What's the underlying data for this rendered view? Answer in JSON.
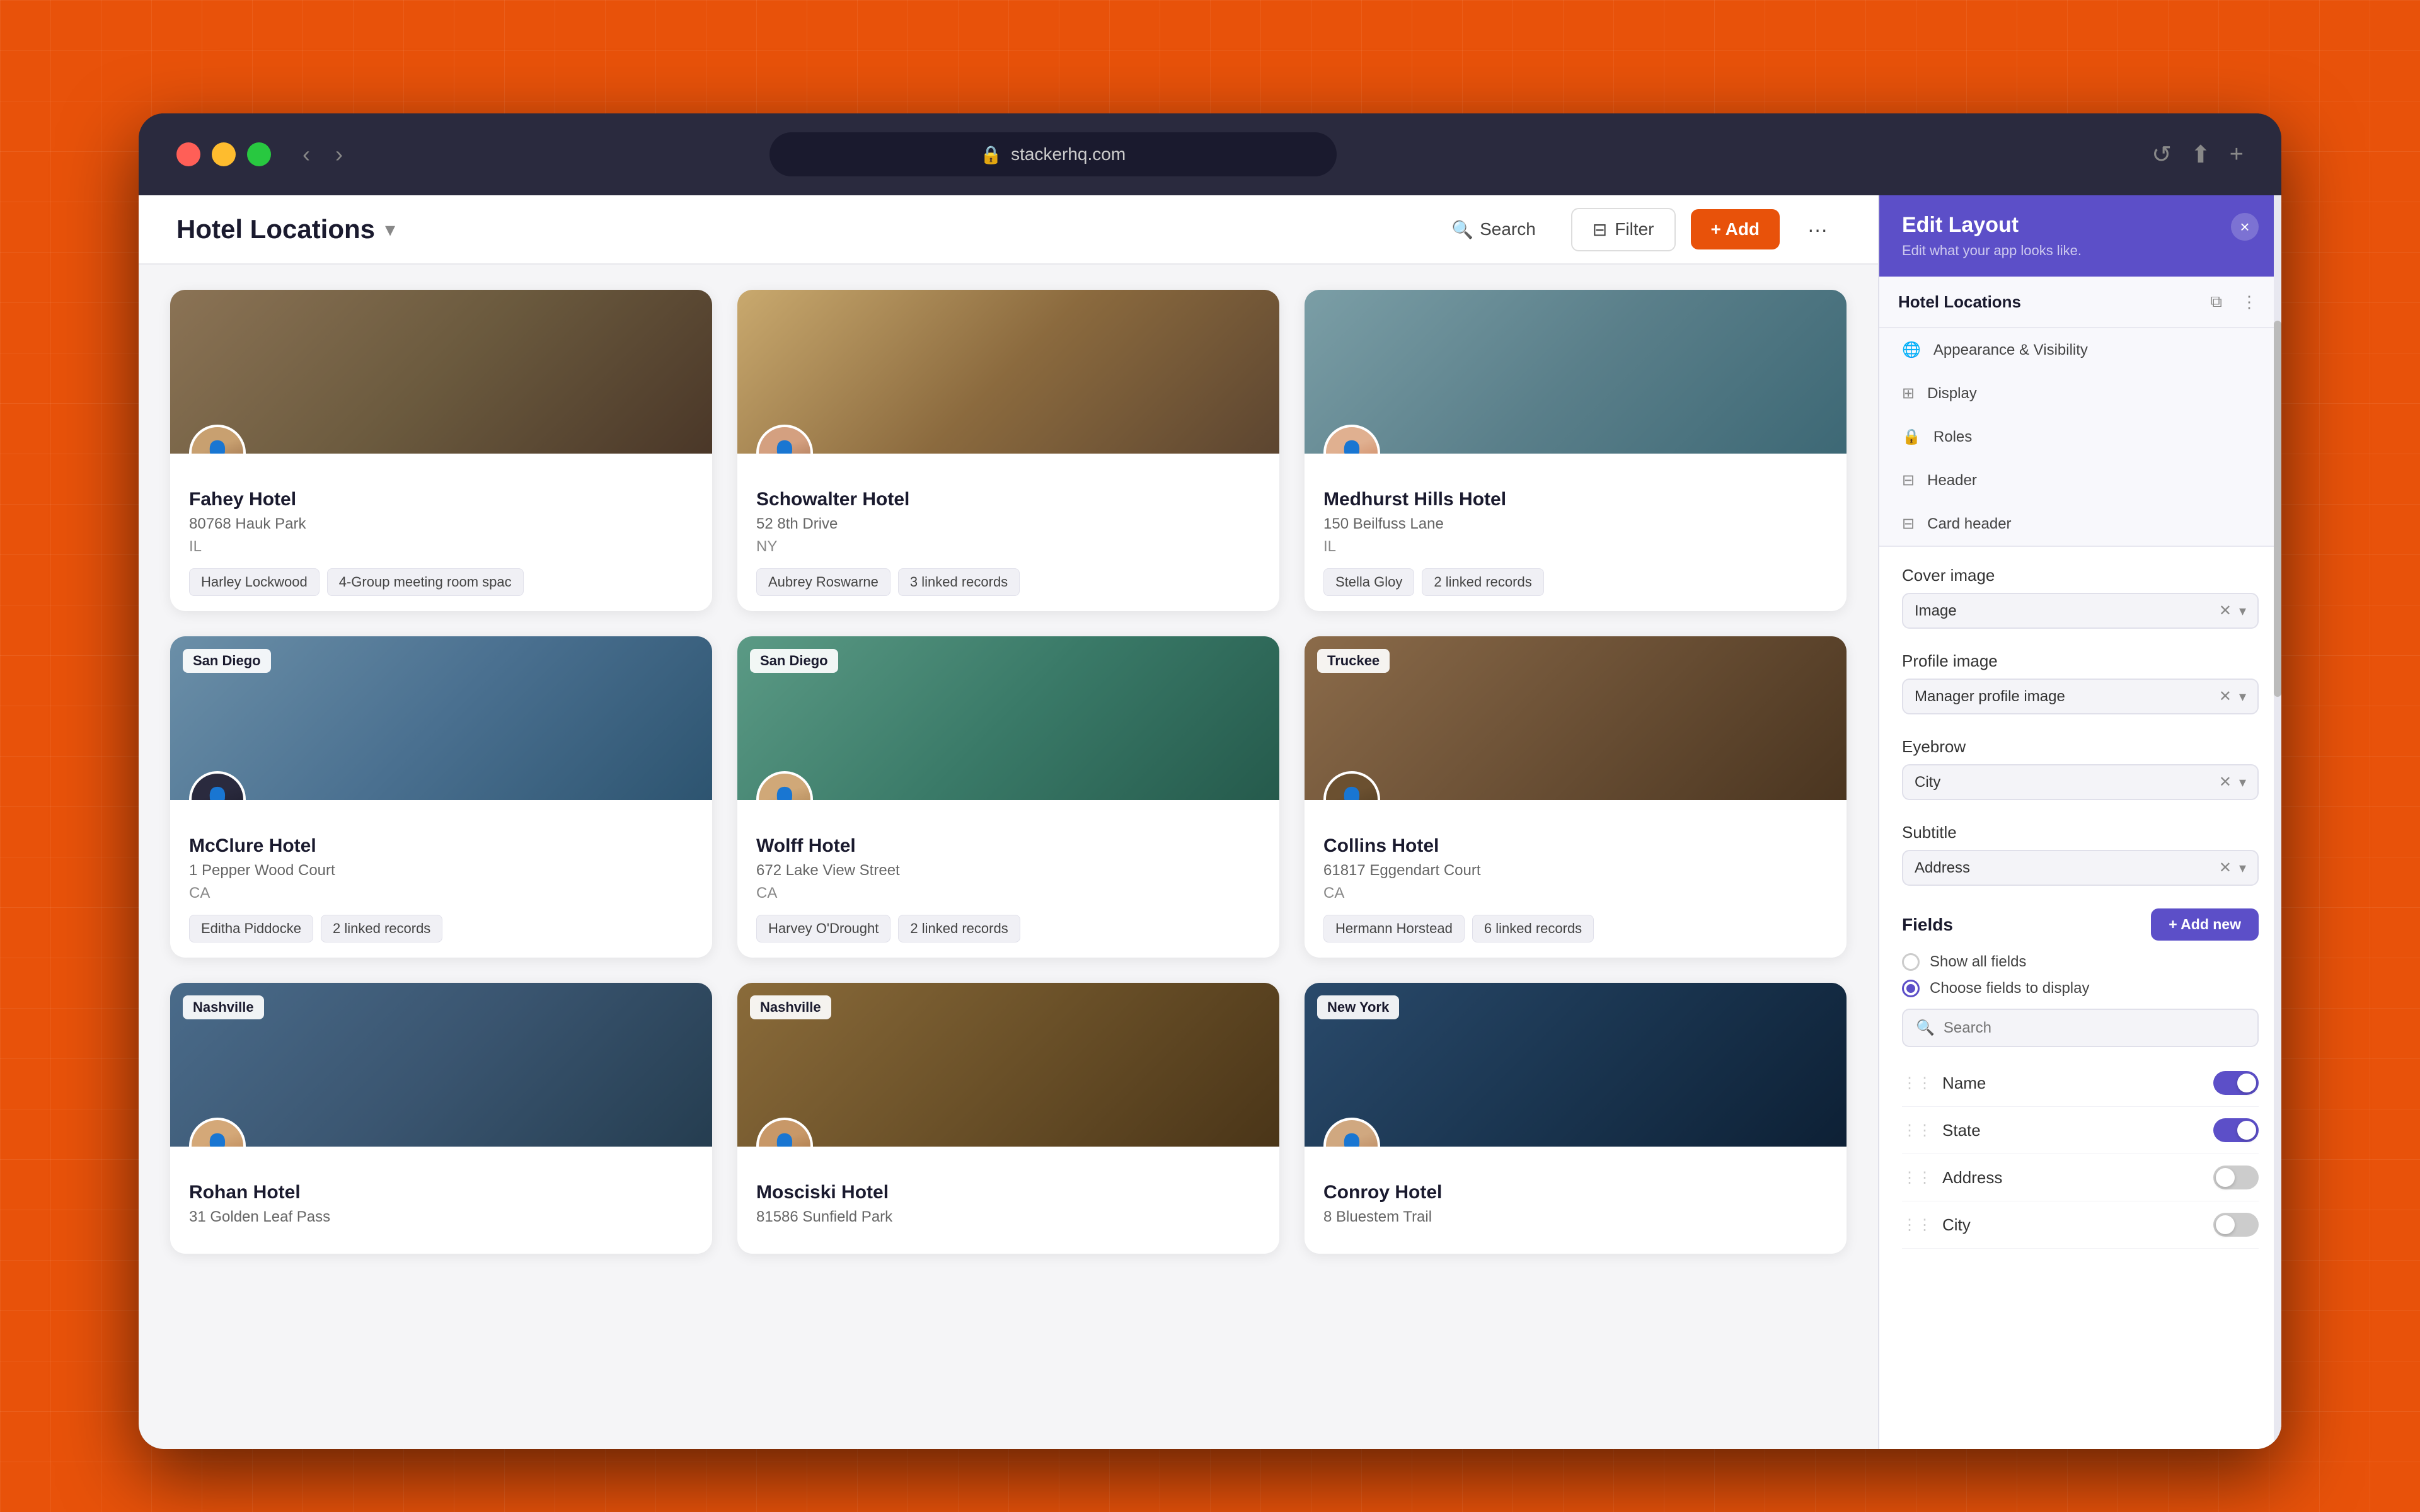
{
  "browser": {
    "url": "stackerhq.com",
    "back_label": "‹",
    "forward_label": "›",
    "reload_label": "↺",
    "share_label": "⬆",
    "new_tab_label": "+"
  },
  "app": {
    "title": "Hotel Locations",
    "header": {
      "search_label": "Search",
      "filter_label": "Filter",
      "add_label": "+ Add",
      "more_label": "···"
    }
  },
  "hotels": [
    {
      "id": "fahey",
      "name": "Fahey Hotel",
      "address": "80768 Hauk Park",
      "state": "IL",
      "manager": "Harley Lockwood",
      "tag2": "4-Group meeting room spac",
      "cover_class": "cover-fahey",
      "profile_class": "profile-fahey",
      "location_badge": null
    },
    {
      "id": "schowalter",
      "name": "Schowalter Hotel",
      "address": "52 8th Drive",
      "state": "NY",
      "manager": "Aubrey Roswarne",
      "tag2": "3 linked records",
      "cover_class": "cover-schowalter",
      "profile_class": "profile-schowalter",
      "location_badge": null
    },
    {
      "id": "medhurst",
      "name": "Medhurst Hills Hotel",
      "address": "150 Beilfuss Lane",
      "state": "IL",
      "manager": "Stella Gloy",
      "tag2": "2 linked records",
      "cover_class": "cover-medhurst",
      "profile_class": "profile-medhurst",
      "location_badge": null
    },
    {
      "id": "mcclure",
      "name": "McClure Hotel",
      "address": "1 Pepper Wood Court",
      "state": "CA",
      "manager": "Editha Piddocke",
      "tag2": "2 linked records",
      "cover_class": "cover-mcclure",
      "profile_class": "profile-mcclure",
      "location_badge": "San Diego"
    },
    {
      "id": "wolff",
      "name": "Wolff Hotel",
      "address": "672 Lake View Street",
      "state": "CA",
      "manager": "Harvey O'Drought",
      "tag2": "2 linked records",
      "cover_class": "cover-wolff",
      "profile_class": "profile-wolff",
      "location_badge": "San Diego"
    },
    {
      "id": "collins",
      "name": "Collins Hotel",
      "address": "61817 Eggendart Court",
      "state": "CA",
      "manager": "Hermann Horstead",
      "tag2": "6 linked records",
      "cover_class": "cover-collins",
      "profile_class": "profile-collins",
      "location_badge": "Truckee"
    },
    {
      "id": "rohan",
      "name": "Rohan Hotel",
      "address": "31 Golden Leaf Pass",
      "state": "",
      "manager": "",
      "tag2": "",
      "cover_class": "cover-rohan",
      "profile_class": "profile-rohan",
      "location_badge": "Nashville"
    },
    {
      "id": "mosciski",
      "name": "Mosciski Hotel",
      "address": "81586 Sunfield Park",
      "state": "",
      "manager": "",
      "tag2": "",
      "cover_class": "cover-mosciski",
      "profile_class": "profile-mosciski",
      "location_badge": "Nashville"
    },
    {
      "id": "conroy",
      "name": "Conroy Hotel",
      "address": "8 Bluestem Trail",
      "state": "",
      "manager": "",
      "tag2": "",
      "cover_class": "cover-conroy",
      "profile_class": "profile-conroy",
      "location_badge": "New York"
    }
  ],
  "edit_layout": {
    "title": "Edit Layout",
    "subtitle": "Edit what your app looks like.",
    "nav_title": "Hotel Locations",
    "close_label": "×",
    "menu_items": [
      {
        "id": "appearance",
        "icon": "🌐",
        "label": "Appearance & Visibility"
      },
      {
        "id": "display",
        "icon": "⊞",
        "label": "Display"
      },
      {
        "id": "roles",
        "icon": "🔒",
        "label": "Roles"
      },
      {
        "id": "header",
        "icon": "⊟",
        "label": "Header"
      },
      {
        "id": "card_header",
        "icon": "⊟",
        "label": "Card header"
      }
    ],
    "cover_image": {
      "label": "Cover image",
      "value": "Image"
    },
    "profile_image": {
      "label": "Profile image",
      "value": "Manager profile image"
    },
    "eyebrow": {
      "label": "Eyebrow",
      "value": "City"
    },
    "subtitle_field": {
      "label": "Subtitle",
      "value": "Address"
    },
    "fields": {
      "label": "Fields",
      "add_new_label": "+ Add new",
      "show_all_label": "Show all fields",
      "choose_fields_label": "Choose fields to display",
      "search_placeholder": "Search",
      "items": [
        {
          "id": "name",
          "label": "Name",
          "enabled": true
        },
        {
          "id": "state",
          "label": "State",
          "enabled": true
        },
        {
          "id": "address",
          "label": "Address",
          "enabled": false
        },
        {
          "id": "city",
          "label": "City",
          "enabled": false
        }
      ]
    }
  }
}
